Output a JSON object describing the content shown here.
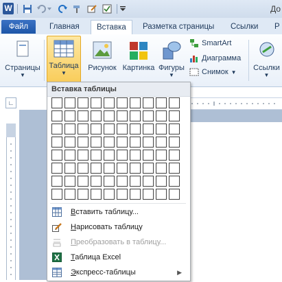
{
  "title_bar": {
    "app_icon_letter": "W",
    "title_partial": "До"
  },
  "tabs": [
    "Файл",
    "Главная",
    "Вставка",
    "Разметка страницы",
    "Ссылки",
    "Р"
  ],
  "ribbon": {
    "pages_label": "Страницы",
    "table_label": "Таблица",
    "picture_label": "Рисунок",
    "clipart_label": "Картинка",
    "shapes_label": "Фигуры",
    "smartart_label": "SmartArt",
    "chart_label": "Диаграмма",
    "screenshot_label": "Снимок",
    "links_label": "Ссылки"
  },
  "dropdown": {
    "header": "Вставка таблицы",
    "grid_cols": 10,
    "grid_rows": 8,
    "items": [
      {
        "label": "Вставить таблицу...",
        "icon": "table-insert-icon",
        "enabled": true
      },
      {
        "label": "Нарисовать таблицу",
        "icon": "pencil-icon",
        "enabled": true
      },
      {
        "label": "Преобразовать в таблицу...",
        "icon": "convert-icon",
        "enabled": false
      },
      {
        "label": "Таблица Excel",
        "icon": "excel-icon",
        "enabled": true
      },
      {
        "label": "Экспресс-таблицы",
        "icon": "quick-tables-icon",
        "enabled": true,
        "submenu": true
      }
    ]
  },
  "colors": {
    "accent": "#2b579a",
    "selected_button": "#f9cd5b"
  }
}
